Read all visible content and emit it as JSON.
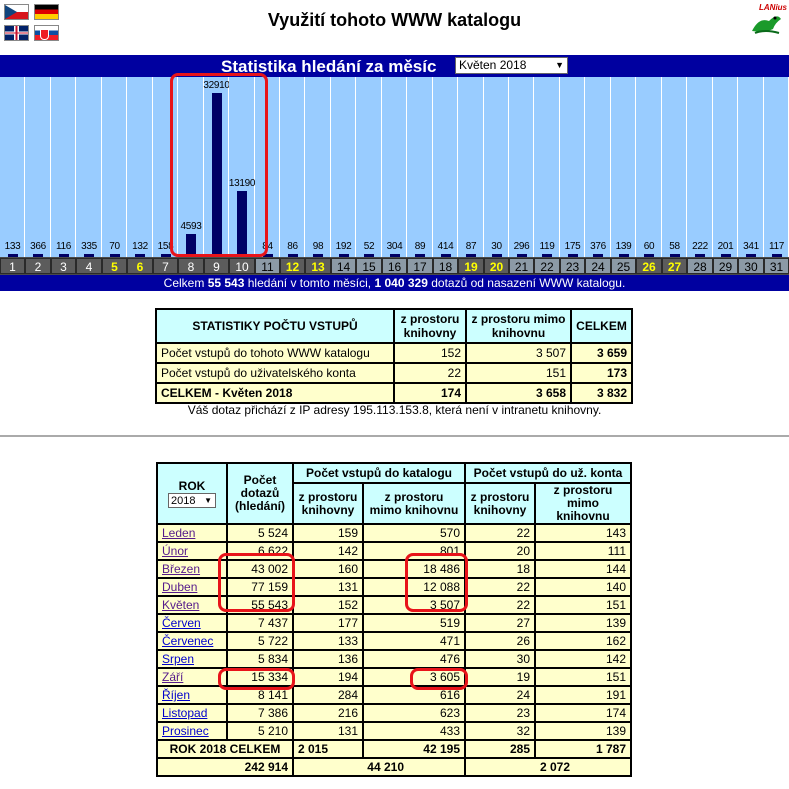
{
  "page_title": "Využití tohoto WWW katalogu",
  "logo_text": "LANius",
  "flags": [
    "cz-flag",
    "de-flag",
    "uk-flag",
    "sk-flag"
  ],
  "stats_header": {
    "title": "Statistika hledání za měsíc",
    "month_selected": "Květen 2018"
  },
  "chart_data": {
    "type": "bar",
    "categories": [
      "1",
      "2",
      "3",
      "4",
      "5",
      "6",
      "7",
      "8",
      "9",
      "10",
      "11",
      "12",
      "13",
      "14",
      "15",
      "16",
      "17",
      "18",
      "19",
      "20",
      "21",
      "22",
      "23",
      "24",
      "25",
      "26",
      "27",
      "28",
      "29",
      "30",
      "31"
    ],
    "values": [
      133,
      366,
      116,
      335,
      70,
      132,
      158,
      4593,
      32910,
      13190,
      84,
      86,
      98,
      192,
      52,
      304,
      89,
      414,
      87,
      30,
      296,
      119,
      175,
      376,
      139,
      60,
      58,
      222,
      201,
      341,
      117
    ],
    "weekend_days": [
      "5",
      "6",
      "12",
      "13",
      "19",
      "20",
      "26",
      "27"
    ],
    "value_labels": [
      "133",
      "366",
      "116",
      "335",
      "70",
      "132",
      "158",
      "4593",
      "32910",
      "13190",
      "84",
      "86",
      "98",
      "192",
      "52",
      "304",
      "89",
      "414",
      "87",
      "30",
      "296",
      "119",
      "175",
      "376",
      "139",
      "60",
      "58",
      "222",
      "201",
      "341",
      "117"
    ],
    "ylim": [
      0,
      32910
    ]
  },
  "summary": {
    "prefix": "Celkem",
    "month_total": "55 543",
    "middle": "hledání v tomto měsíci,",
    "all_total": "1 040 329",
    "suffix": "dotazů od nasazení WWW katalogu."
  },
  "visits_table": {
    "title": "STATISTIKY POČTU VSTUPŮ",
    "col_inside": "z prostoru knihovny",
    "col_outside": "z prostoru mimo knihovnu",
    "col_total": "CELKEM",
    "rows": [
      {
        "label": "Počet vstupů do tohoto WWW katalogu",
        "inside": "152",
        "outside": "3 507",
        "total": "3 659"
      },
      {
        "label": "Počet vstupů do uživatelského konta",
        "inside": "22",
        "outside": "151",
        "total": "173"
      },
      {
        "label": "CELKEM - Květen 2018",
        "inside": "174",
        "outside": "3 658",
        "total": "3 832"
      }
    ]
  },
  "ip_note": "Váš dotaz přichází z IP adresy 195.113.153.8, která není v intranetu knihovny.",
  "year_table": {
    "col_year": "ROK",
    "year_selected": "2018",
    "col_queries": "Počet dotazů (hledání)",
    "group_catalog": "Počet vstupů do katalogu",
    "group_account": "Počet vstupů do už. konta",
    "sub_inside": "z prostoru knihovny",
    "sub_outside": "z prostoru mimo knihovnu",
    "rows": [
      {
        "month": "Leden",
        "queries": "5 524",
        "cat_in": "159",
        "cat_out": "570",
        "acc_in": "22",
        "acc_out": "143"
      },
      {
        "month": "Únor",
        "queries": "6 622",
        "cat_in": "142",
        "cat_out": "801",
        "acc_in": "20",
        "acc_out": "111"
      },
      {
        "month": "Březen",
        "queries": "43 002",
        "cat_in": "160",
        "cat_out": "18 486",
        "acc_in": "18",
        "acc_out": "144"
      },
      {
        "month": "Duben",
        "queries": "77 159",
        "cat_in": "131",
        "cat_out": "12 088",
        "acc_in": "22",
        "acc_out": "140"
      },
      {
        "month": "Květen",
        "queries": "55 543",
        "cat_in": "152",
        "cat_out": "3 507",
        "acc_in": "22",
        "acc_out": "151"
      },
      {
        "month": "Červen",
        "queries": "7 437",
        "cat_in": "177",
        "cat_out": "519",
        "acc_in": "27",
        "acc_out": "139"
      },
      {
        "month": "Červenec",
        "queries": "5 722",
        "cat_in": "133",
        "cat_out": "471",
        "acc_in": "26",
        "acc_out": "162"
      },
      {
        "month": "Srpen",
        "queries": "5 834",
        "cat_in": "136",
        "cat_out": "476",
        "acc_in": "30",
        "acc_out": "142"
      },
      {
        "month": "Září",
        "queries": "15 334",
        "cat_in": "194",
        "cat_out": "3 605",
        "acc_in": "19",
        "acc_out": "151"
      },
      {
        "month": "Říjen",
        "queries": "8 141",
        "cat_in": "284",
        "cat_out": "616",
        "acc_in": "24",
        "acc_out": "191"
      },
      {
        "month": "Listopad",
        "queries": "7 386",
        "cat_in": "216",
        "cat_out": "623",
        "acc_in": "23",
        "acc_out": "174"
      },
      {
        "month": "Prosinec",
        "queries": "5 210",
        "cat_in": "131",
        "cat_out": "433",
        "acc_in": "32",
        "acc_out": "139"
      }
    ],
    "total_label": "ROK 2018 CELKEM",
    "total_cat_in": "2 015",
    "total_cat_out": "42 195",
    "total_acc_in": "285",
    "total_acc_out": "1 787",
    "grand_queries": "242 914",
    "grand_catalog": "44 210",
    "grand_account": "2 072"
  },
  "colors": {
    "header_blue": "#0000a0",
    "chart_bg": "#99ccff",
    "bar": "#000066",
    "highlight": "#e8141a",
    "table_cell": "#ffffcc",
    "table_header": "#ccffff"
  }
}
